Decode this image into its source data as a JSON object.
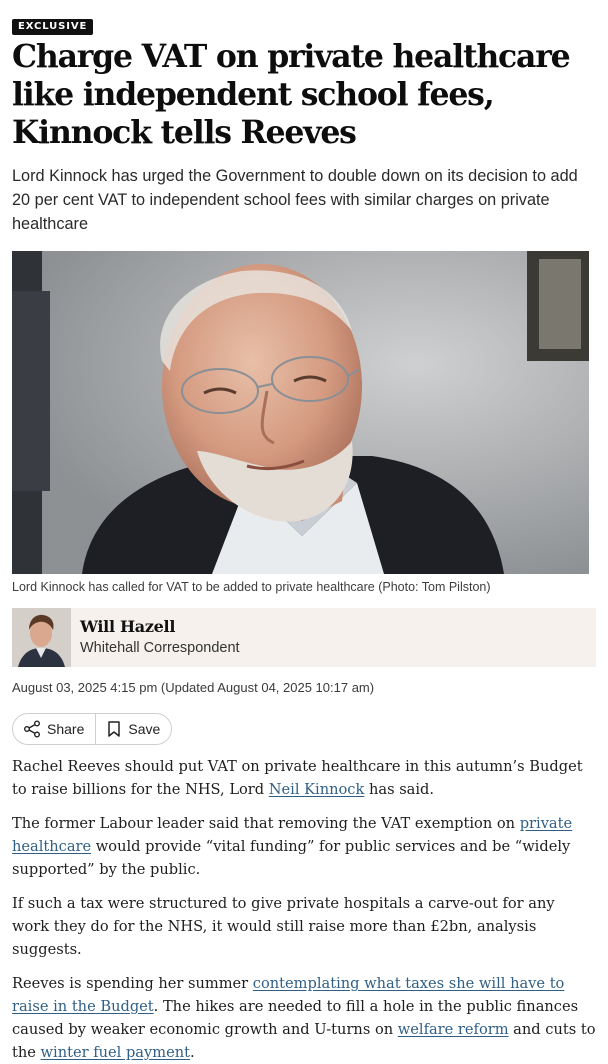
{
  "article": {
    "badge": "EXCLUSIVE",
    "headline": "Charge VAT on private healthcare like independent school fees, Kinnock tells Reeves",
    "standfirst": "Lord Kinnock has urged the Government to double down on its decision to add 20 per cent VAT to independent school fees with similar charges on private healthcare",
    "image_caption": "Lord Kinnock has called for VAT to be added to private healthcare (Photo: Tom Pilston)",
    "author": {
      "name": "Will Hazell",
      "role": "Whitehall Correspondent"
    },
    "dateline": "August 03, 2025 4:15 pm (Updated August 04, 2025 10:17 am)",
    "actions": {
      "share_label": "Share",
      "save_label": "Save"
    },
    "paragraphs": {
      "p1_before": "Rachel Reeves should put VAT on private healthcare in this autumn’s Budget to raise billions for the NHS, Lord ",
      "p1_link": "Neil Kinnock",
      "p1_after": " has said.",
      "p2_before": "The former Labour leader said that removing the VAT exemption on ",
      "p2_link": "private healthcare",
      "p2_after": " would provide “vital funding” for public services and be “widely supported” by the public.",
      "p3": "If such a tax were structured to give private hospitals a carve-out for any work they do for the NHS, it would still raise more than £2bn, analysis suggests.",
      "p4_before": "Reeves is spending her summer ",
      "p4_link1": "contemplating what taxes she will have to raise in the Budget",
      "p4_mid": ". The hikes are needed to fill a hole in the public finances caused by weaker economic growth and U-turns on ",
      "p4_link2": "welfare reform",
      "p4_mid2": " and cuts to the ",
      "p4_link3": "winter fuel payment",
      "p4_after": "."
    }
  },
  "colors": {
    "link": "#2f5f87",
    "author_bg": "#f6f1ec",
    "badge_bg": "#111111"
  }
}
